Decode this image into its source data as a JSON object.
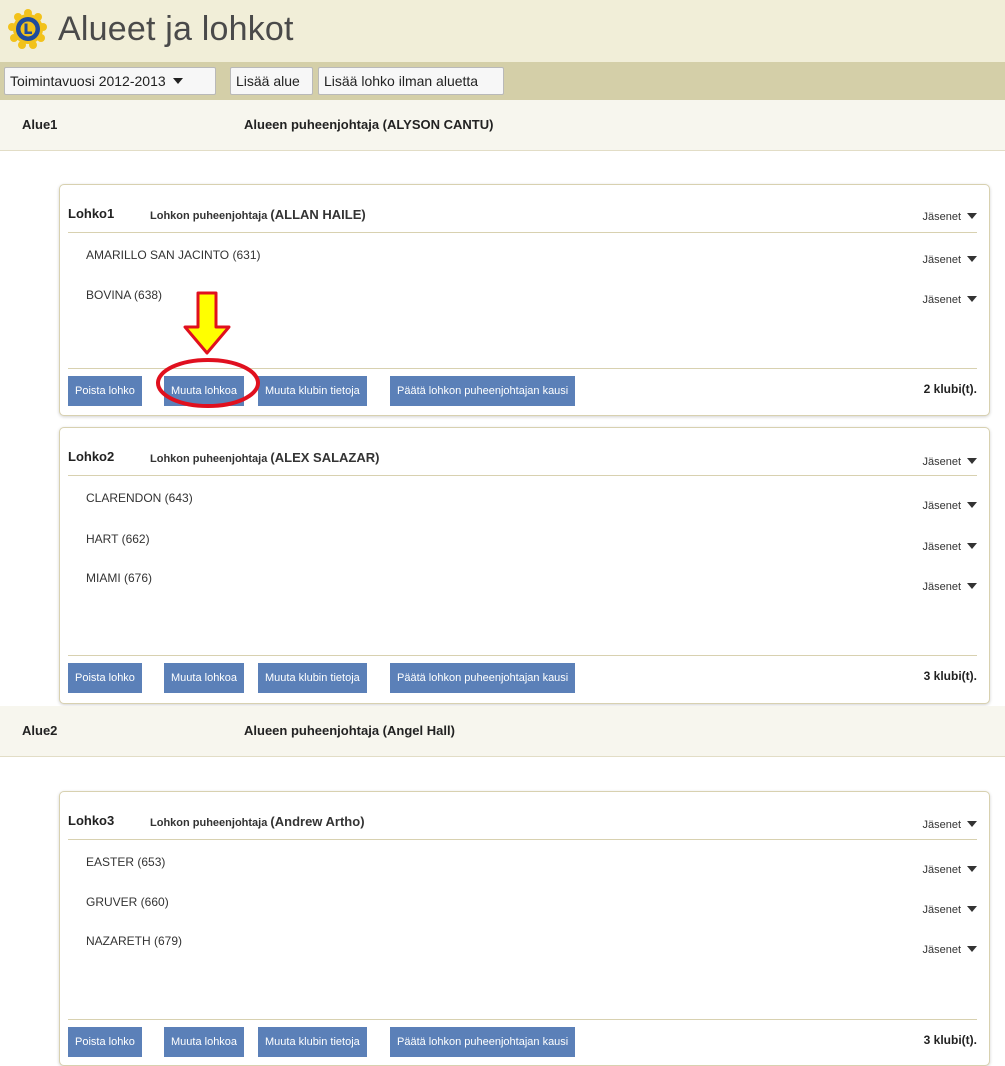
{
  "page": {
    "title": "Alueet ja lohkot"
  },
  "toolbar": {
    "year_select": "Toimintavuosi 2012-2013",
    "add_area": "Lisää alue",
    "add_block_without_area": "Lisää lohko ilman aluetta"
  },
  "common": {
    "members_label": "Jäsenet",
    "delete_block": "Poista lohko",
    "edit_block": "Muuta lohkoa",
    "edit_club_info": "Muuta klubin tietoja",
    "end_chair_term": "Päätä lohkon puheenjohtajan kausi",
    "block_chair_prefix": "Lohkon puheenjohtaja"
  },
  "areas": [
    {
      "name": "Alue1",
      "chair": "Alueen puheenjohtaja (ALYSON CANTU)",
      "blocks": [
        {
          "name": "Lohko1",
          "chair_name": "(ALLAN HAILE)",
          "clubs": [
            "AMARILLO SAN JACINTO (631)",
            "BOVINA (638)"
          ],
          "club_count": "2  klubi(t)."
        },
        {
          "name": "Lohko2",
          "chair_name": "(ALEX SALAZAR)",
          "clubs": [
            "CLARENDON (643)",
            "HART (662)",
            "MIAMI (676)"
          ],
          "club_count": "3  klubi(t)."
        }
      ]
    },
    {
      "name": "Alue2",
      "chair": "Alueen puheenjohtaja (Angel Hall)",
      "blocks": [
        {
          "name": "Lohko3",
          "chair_name": "(Andrew Artho)",
          "clubs": [
            "EASTER (653)",
            "GRUVER (660)",
            "NAZARETH (679)"
          ],
          "club_count": "3  klubi(t)."
        }
      ]
    }
  ],
  "colors": {
    "title_bg": "#f1eed8",
    "toolbar_bg": "#d4cfa8",
    "action_button": "#5b80b8",
    "annotation_arrow": "#ffff00",
    "annotation_circle": "#e0101e"
  },
  "icons": {
    "logo": "lions-logo-icon",
    "dropdown": "caret-down-icon",
    "annotation": "down-arrow-icon"
  }
}
